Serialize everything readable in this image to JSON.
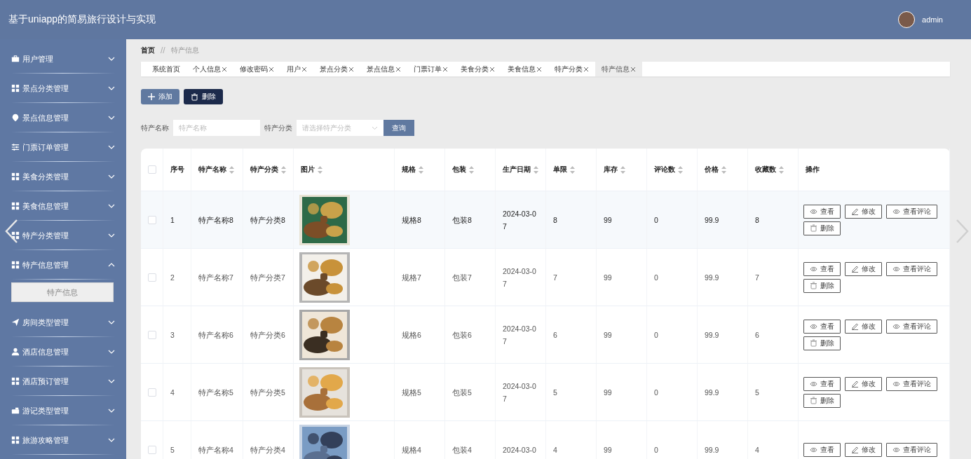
{
  "header": {
    "title": "基于uniapp的简易旅行设计与实现",
    "user": "admin"
  },
  "sidebar": {
    "items": [
      {
        "label": "用户管理",
        "expanded": false
      },
      {
        "label": "景点分类管理",
        "expanded": false
      },
      {
        "label": "景点信息管理",
        "expanded": false
      },
      {
        "label": "门票订单管理",
        "expanded": false
      },
      {
        "label": "美食分类管理",
        "expanded": false
      },
      {
        "label": "美食信息管理",
        "expanded": false
      },
      {
        "label": "特产分类管理",
        "expanded": false
      },
      {
        "label": "特产信息管理",
        "expanded": true,
        "children": [
          {
            "label": "特产信息",
            "selected": true
          }
        ]
      },
      {
        "label": "房间类型管理",
        "expanded": false
      },
      {
        "label": "酒店信息管理",
        "expanded": false
      },
      {
        "label": "酒店预订管理",
        "expanded": false
      },
      {
        "label": "游记类型管理",
        "expanded": false
      },
      {
        "label": "旅游攻略管理",
        "expanded": false
      }
    ]
  },
  "breadcrumb": {
    "items": [
      "首页",
      "特产信息"
    ],
    "separator": "//"
  },
  "tabs": [
    {
      "label": "系统首页",
      "closable": false,
      "selected": false
    },
    {
      "label": "个人信息",
      "closable": true,
      "selected": false
    },
    {
      "label": "修改密码",
      "closable": true,
      "selected": false
    },
    {
      "label": "用户",
      "closable": true,
      "selected": false
    },
    {
      "label": "景点分类",
      "closable": true,
      "selected": false
    },
    {
      "label": "景点信息",
      "closable": true,
      "selected": false
    },
    {
      "label": "门票订单",
      "closable": true,
      "selected": false
    },
    {
      "label": "美食分类",
      "closable": true,
      "selected": false
    },
    {
      "label": "美食信息",
      "closable": true,
      "selected": false
    },
    {
      "label": "特产分类",
      "closable": true,
      "selected": false
    },
    {
      "label": "特产信息",
      "closable": true,
      "selected": true
    }
  ],
  "toolbar": {
    "buttons": [
      {
        "kind": "add",
        "label": "添加"
      },
      {
        "kind": "delete",
        "label": "删除"
      }
    ]
  },
  "search": {
    "fields": [
      {
        "kind": "text",
        "label": "特产名称",
        "placeholder": "特产名称"
      },
      {
        "kind": "select",
        "label": "特产分类",
        "placeholder": "请选择特产分类"
      }
    ],
    "button": "查询"
  },
  "table": {
    "columns": [
      {
        "kind": "check",
        "checked": false
      },
      {
        "kind": "text",
        "label": "序号",
        "sortable": false
      },
      {
        "kind": "text",
        "label": "特产名称",
        "sortable": true
      },
      {
        "kind": "text",
        "label": "特产分类",
        "sortable": true
      },
      {
        "kind": "picture",
        "label": "图片",
        "sortable": true
      },
      {
        "kind": "text",
        "label": "规格",
        "sortable": true
      },
      {
        "kind": "text",
        "label": "包装",
        "sortable": true
      },
      {
        "kind": "text",
        "label": "生产日期",
        "sortable": true
      },
      {
        "kind": "text",
        "label": "单限",
        "sortable": true
      },
      {
        "kind": "text",
        "label": "库存",
        "sortable": true
      },
      {
        "kind": "text",
        "label": "评论数",
        "sortable": true
      },
      {
        "kind": "text",
        "label": "价格",
        "sortable": true
      },
      {
        "kind": "text",
        "label": "收藏数",
        "sortable": true
      },
      {
        "kind": "actions",
        "label": "操作",
        "sortable": false
      }
    ],
    "rows": [
      {
        "hovered": true,
        "cells": [
          {
            "checked": false
          },
          "1",
          "特产名称8",
          "特产分类8",
          {
            "kind": "picture"
          },
          "规格8",
          "包装8",
          "2024-03-07",
          "8",
          "99",
          "0",
          "99.9",
          "8",
          [
            {
              "kind": "view",
              "label": "查看"
            },
            {
              "kind": "edit",
              "label": "修改"
            },
            {
              "kind": "view",
              "label": "查看评论"
            },
            {
              "kind": "delete",
              "label": "删除"
            }
          ]
        ]
      },
      {
        "hovered": false,
        "cells": [
          {
            "checked": false
          },
          "2",
          "特产名称7",
          "特产分类7",
          {
            "kind": "picture"
          },
          "规格7",
          "包装7",
          "2024-03-07",
          "7",
          "99",
          "0",
          "99.9",
          "7",
          [
            {
              "kind": "view",
              "label": "查看"
            },
            {
              "kind": "edit",
              "label": "修改"
            },
            {
              "kind": "view",
              "label": "查看评论"
            },
            {
              "kind": "delete",
              "label": "删除"
            }
          ]
        ]
      },
      {
        "hovered": false,
        "cells": [
          {
            "checked": false
          },
          "3",
          "特产名称6",
          "特产分类6",
          {
            "kind": "picture"
          },
          "规格6",
          "包装6",
          "2024-03-07",
          "6",
          "99",
          "0",
          "99.9",
          "6",
          [
            {
              "kind": "view",
              "label": "查看"
            },
            {
              "kind": "edit",
              "label": "修改"
            },
            {
              "kind": "view",
              "label": "查看评论"
            },
            {
              "kind": "delete",
              "label": "删除"
            }
          ]
        ]
      },
      {
        "hovered": false,
        "cells": [
          {
            "checked": false
          },
          "4",
          "特产名称5",
          "特产分类5",
          {
            "kind": "picture"
          },
          "规格5",
          "包装5",
          "2024-03-07",
          "5",
          "99",
          "0",
          "99.9",
          "5",
          [
            {
              "kind": "view",
              "label": "查看"
            },
            {
              "kind": "edit",
              "label": "修改"
            },
            {
              "kind": "view",
              "label": "查看评论"
            },
            {
              "kind": "delete",
              "label": "删除"
            }
          ]
        ]
      },
      {
        "hovered": false,
        "cells": [
          {
            "checked": false
          },
          "5",
          "特产名称4",
          "特产分类4",
          {
            "kind": "picture"
          },
          "规格4",
          "包装4",
          "2024-03-0",
          "4",
          "99",
          "0",
          "99.9",
          "4",
          [
            {
              "kind": "view",
              "label": "查看"
            },
            {
              "kind": "edit",
              "label": "修改"
            },
            {
              "kind": "view",
              "label": "查看评论"
            }
          ]
        ]
      }
    ]
  }
}
